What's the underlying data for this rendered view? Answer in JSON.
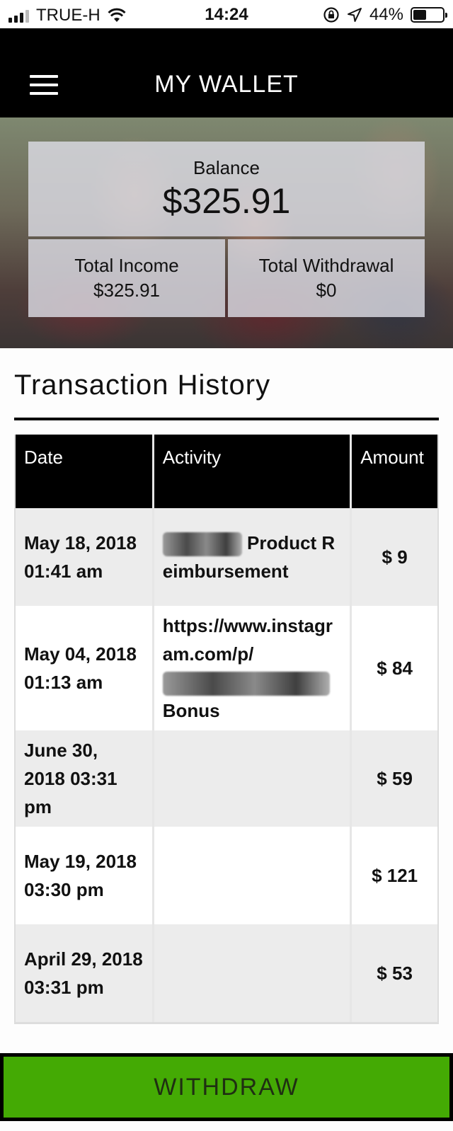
{
  "status_bar": {
    "carrier": "TRUE-H",
    "time": "14:24",
    "battery_percent": "44%",
    "battery_level": 0.44,
    "icons": [
      "signal-icon",
      "wifi-icon",
      "rotation-lock-icon",
      "location-arrow-icon",
      "battery-icon"
    ]
  },
  "header": {
    "title": "MY WALLET",
    "menu_icon": "hamburger-menu-icon"
  },
  "summary": {
    "balance_label": "Balance",
    "balance_value": "$325.91",
    "income_label": "Total Income",
    "income_value": "$325.91",
    "withdrawal_label": "Total Withdrawal",
    "withdrawal_value": "$0"
  },
  "history": {
    "title": "Transaction History",
    "columns": [
      "Date",
      "Activity",
      "Amount"
    ],
    "rows": [
      {
        "date": "May 18, 2018 01:41 am",
        "activity_parts": [
          "Product Reimbursement"
        ],
        "amount": "$ 9"
      },
      {
        "date": "May 04, 2018 01:13 am",
        "activity_parts": [
          "https://www.instagram.com/p/",
          "Bonus"
        ],
        "amount": "$ 84"
      },
      {
        "date": "June 30, 2018 03:31 pm",
        "activity_parts": [],
        "amount": "$ 59"
      },
      {
        "date": "May 19, 2018 03:30 pm",
        "activity_parts": [],
        "amount": "$ 121"
      },
      {
        "date": "April 29, 2018 03:31 pm",
        "activity_parts": [],
        "amount": "$ 53"
      }
    ]
  },
  "actions": {
    "withdraw_label": "WITHDRAW",
    "withdraw_color": "#44aa04"
  }
}
